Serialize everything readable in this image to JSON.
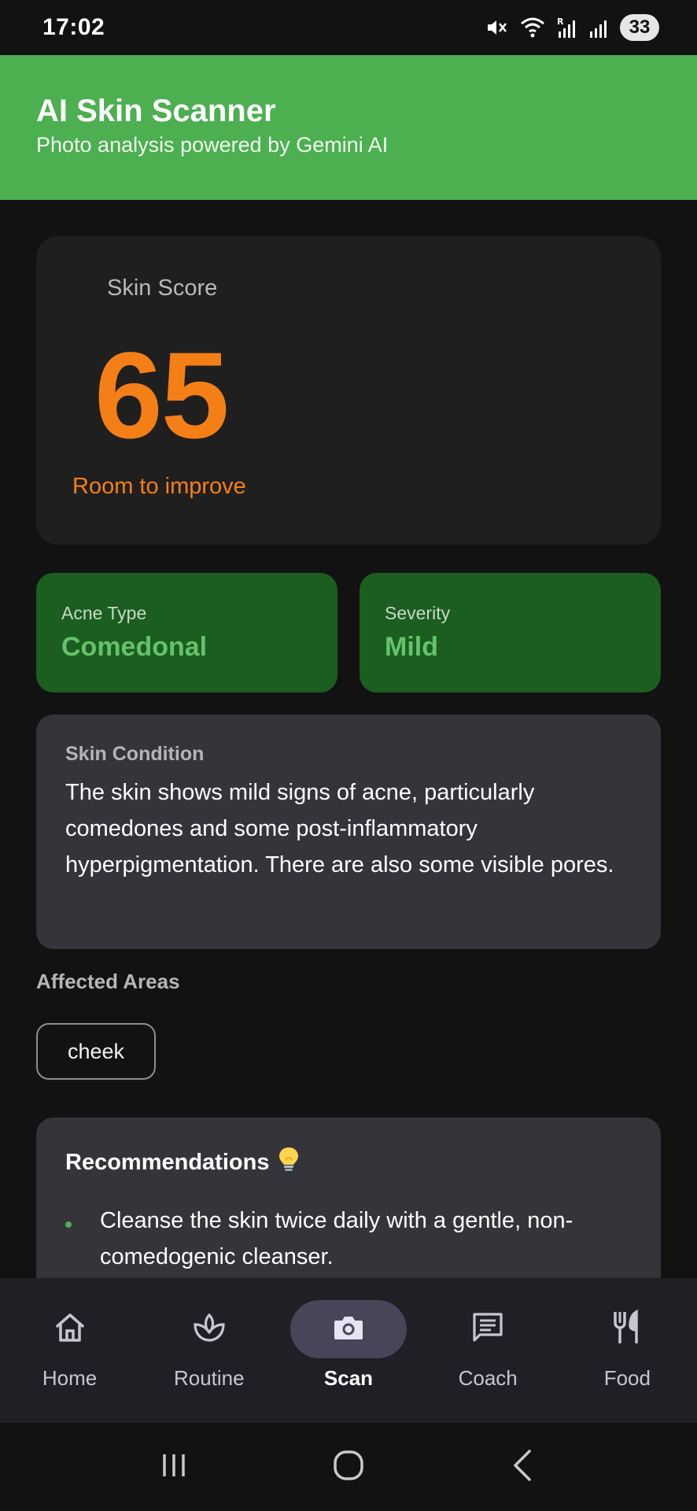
{
  "status_bar": {
    "time": "17:02",
    "battery": "33",
    "icons": [
      "mute-icon",
      "wifi-icon",
      "signal-r-icon",
      "signal-icon"
    ]
  },
  "header": {
    "title": "AI Skin Scanner",
    "subtitle": "Photo analysis powered by Gemini AI",
    "color": "#4caf50"
  },
  "score": {
    "label": "Skin Score",
    "value": "65",
    "status": "Room to improve",
    "color": "#f57f17"
  },
  "acne_type": {
    "label": "Acne Type",
    "value": "Comedonal"
  },
  "severity": {
    "label": "Severity",
    "value": "Mild"
  },
  "condition": {
    "title": "Skin Condition",
    "text": "The skin shows mild signs of acne, particularly comedones and some post-inflammatory hyperpigmentation. There are also some visible pores."
  },
  "affected": {
    "title": "Affected Areas",
    "areas": [
      "cheek"
    ]
  },
  "recommendations": {
    "title": "Recommendations",
    "icon": "lightbulb-icon",
    "items": [
      "Cleanse the skin twice daily with a gentle, non-comedogenic cleanser."
    ]
  },
  "nav": {
    "items": [
      {
        "label": "Home",
        "icon": "home-icon",
        "active": false
      },
      {
        "label": "Routine",
        "icon": "routine-icon",
        "active": false
      },
      {
        "label": "Scan",
        "icon": "camera-icon",
        "active": true
      },
      {
        "label": "Coach",
        "icon": "chat-icon",
        "active": false
      },
      {
        "label": "Food",
        "icon": "food-icon",
        "active": false
      }
    ]
  }
}
